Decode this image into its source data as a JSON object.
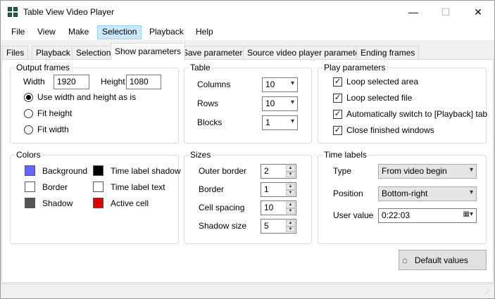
{
  "window": {
    "title": "Table View Video Player",
    "controls": {
      "minimize": "—",
      "maximize": "☐",
      "close": "✕"
    }
  },
  "menu": [
    "File",
    "View",
    "Make",
    "Selection",
    "Playback",
    "Help"
  ],
  "menu_active": "Selection",
  "tabs": [
    "Files",
    "Playback",
    "Selection",
    "Show parameters",
    "Save parameters",
    "Source video player parameters",
    "Ending frames"
  ],
  "active_tab": "Show parameters",
  "output_frames": {
    "title": "Output frames",
    "width_label": "Width",
    "width_value": "1920",
    "height_label": "Height",
    "height_value": "1080",
    "options": [
      "Use width and height as is",
      "Fit height",
      "Fit width"
    ],
    "selected": 0
  },
  "table": {
    "title": "Table",
    "columns_label": "Columns",
    "columns_value": "10",
    "rows_label": "Rows",
    "rows_value": "10",
    "blocks_label": "Blocks",
    "blocks_value": "1"
  },
  "play_parameters": {
    "title": "Play parameters",
    "items": [
      {
        "label": "Loop selected area",
        "checked": true
      },
      {
        "label": "Loop selected file",
        "checked": true
      },
      {
        "label": "Automatically switch to [Playback] tab",
        "checked": true
      },
      {
        "label": "Close finished windows",
        "checked": true
      }
    ]
  },
  "colors": {
    "title": "Colors",
    "items": [
      {
        "label": "Background",
        "color": "#6666ff"
      },
      {
        "label": "Border",
        "color": "#ffffff"
      },
      {
        "label": "Shadow",
        "color": "#555555"
      },
      {
        "label": "Time label shadow",
        "color": "#000000"
      },
      {
        "label": "Time label text",
        "color": "#ffffff"
      },
      {
        "label": "Active cell",
        "color": "#e00000"
      }
    ]
  },
  "sizes": {
    "title": "Sizes",
    "outer_border_label": "Outer border",
    "outer_border_value": "2",
    "border_label": "Border",
    "border_value": "1",
    "cell_spacing_label": "Cell spacing",
    "cell_spacing_value": "10",
    "shadow_size_label": "Shadow size",
    "shadow_size_value": "5"
  },
  "time_labels": {
    "title": "Time labels",
    "type_label": "Type",
    "type_value": "From video begin",
    "position_label": "Position",
    "position_value": "Bottom-right",
    "user_value_label": "User value",
    "user_value": "0:22:03"
  },
  "default_values_button": "Default values"
}
